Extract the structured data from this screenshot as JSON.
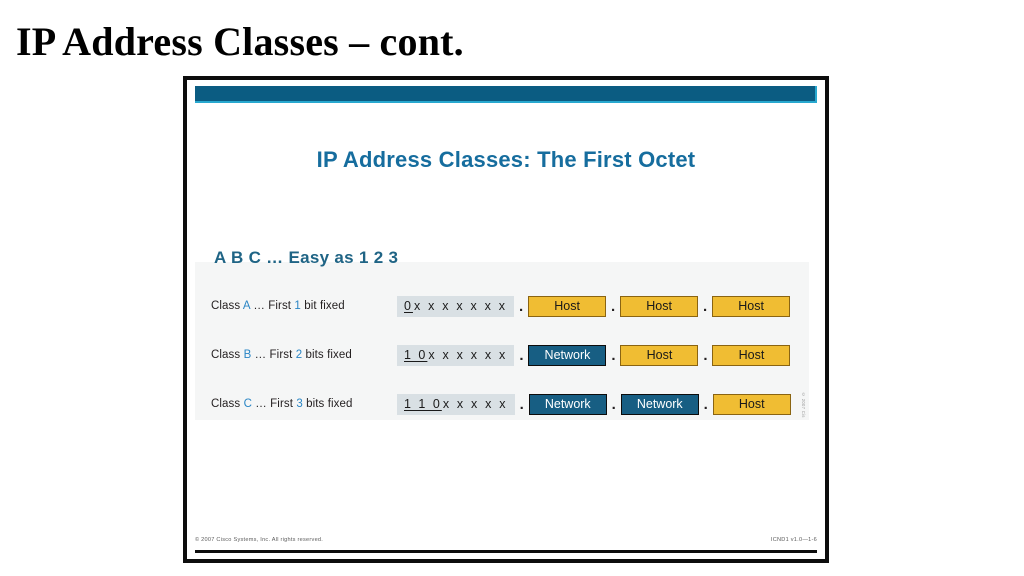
{
  "page": {
    "title": "IP Address Classes – cont."
  },
  "slide": {
    "heading": "IP Address Classes: The First Octet",
    "subheading": "A B C … Easy as 1 2 3",
    "rows": [
      {
        "label_prefix": "Class ",
        "class_letter": "A",
        "label_middle": " … First ",
        "bit_count": "1",
        "label_suffix": " bit fixed",
        "fixed_bits": "0",
        "variable_bits": "x x x x x x x",
        "segments": [
          {
            "text": "Host",
            "kind": "host"
          },
          {
            "text": "Host",
            "kind": "host"
          },
          {
            "text": "Host",
            "kind": "host"
          }
        ]
      },
      {
        "label_prefix": "Class ",
        "class_letter": "B",
        "label_middle": " … First ",
        "bit_count": "2",
        "label_suffix": " bits fixed",
        "fixed_bits": "1 0",
        "variable_bits": "x x x x x x",
        "segments": [
          {
            "text": "Network",
            "kind": "network"
          },
          {
            "text": "Host",
            "kind": "host"
          },
          {
            "text": "Host",
            "kind": "host"
          }
        ]
      },
      {
        "label_prefix": "Class ",
        "class_letter": "C",
        "label_middle": " … First ",
        "bit_count": "3",
        "label_suffix": " bits fixed",
        "fixed_bits": "1 1 0",
        "variable_bits": "x x x x x",
        "segments": [
          {
            "text": "Network",
            "kind": "network"
          },
          {
            "text": "Network",
            "kind": "network"
          },
          {
            "text": "Host",
            "kind": "host"
          }
        ]
      }
    ],
    "separator": ".",
    "watermark": "© 2007 Cisco",
    "footer": {
      "copyright": "© 2007 Cisco Systems, Inc. All rights reserved.",
      "course_code": "ICND1 v1.0—1-6"
    }
  },
  "colors": {
    "topbar": "#0b5c82",
    "topbar_edge": "#28a8cf",
    "heading": "#166d9e",
    "subheading": "#1f6485",
    "accent_letter": "#2b86c5",
    "host_fill": "#f0bd33",
    "host_border": "#8a6412",
    "network_fill": "#175e83",
    "octet_fill": "#d9e0e4",
    "band": "#f5f6f6"
  }
}
